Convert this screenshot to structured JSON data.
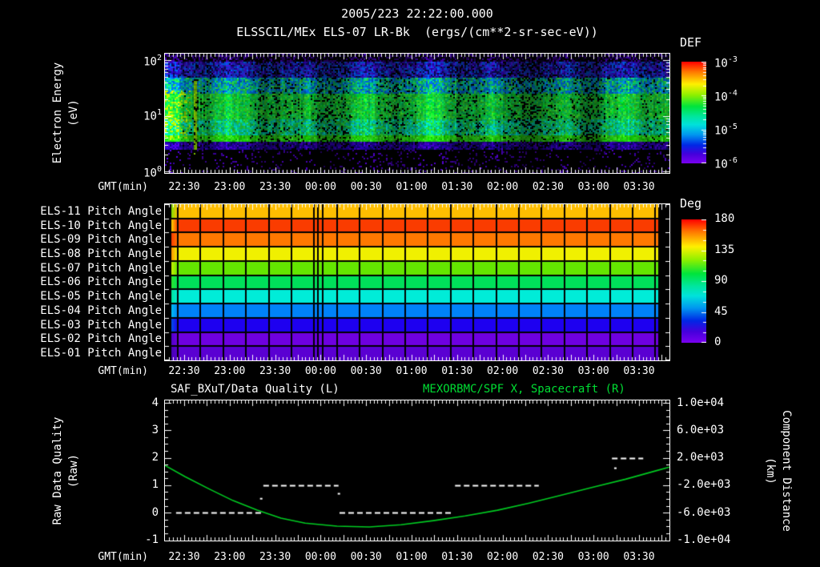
{
  "header": {
    "timestamp": "2005/223 22:22:00.000",
    "instrument_title": "ELSSCIL/MEx ELS-07 LR-Bk  (ergs/(cm**2-sr-sec-eV))"
  },
  "time_axis": {
    "label": "GMT(min)",
    "ticks": [
      "22:30",
      "23:00",
      "23:30",
      "00:00",
      "00:30",
      "01:00",
      "01:30",
      "02:00",
      "02:30",
      "03:00",
      "03:30"
    ]
  },
  "spectrogram_panel": {
    "ylabel_line1": "Electron Energy",
    "ylabel_line2": "(eV)",
    "ytick_exponents": [
      "2",
      "1",
      "0"
    ],
    "colorbar": {
      "title": "DEF",
      "tick_exponents": [
        "-3",
        "-4",
        "-5",
        "-6"
      ]
    }
  },
  "pitch_panel": {
    "colorbar": {
      "title": "Deg",
      "ticks": [
        "180",
        "135",
        "90",
        "45",
        "0"
      ]
    }
  },
  "quality_panel": {
    "title_left": "SAF_BXuT/Data Quality (L)",
    "title_right": "MEXORBMC/SPF X, Spacecraft (R)",
    "title_right_color": "#00DD33",
    "ylabel_left_line1": "Raw Data Quality",
    "ylabel_left_line2": "(Raw)",
    "ylabel_right_line1": "Component Distance",
    "ylabel_right_line2": "(km)",
    "yticks_left": [
      "4",
      "3",
      "2",
      "1",
      "0",
      "-1"
    ],
    "yticks_right": [
      "1.0e+04",
      "6.0e+03",
      "2.0e+03",
      "-2.0e+03",
      "-6.0e+03",
      "-1.0e+04"
    ]
  },
  "colors": {
    "background": "#000000",
    "frame": "#FFFFFF",
    "text": "#FFFFFF",
    "accent_green": "#00DD33",
    "rainbow": [
      [
        0,
        "#FF0000"
      ],
      [
        0.1,
        "#FF7800"
      ],
      [
        0.22,
        "#FFF000"
      ],
      [
        0.33,
        "#8CF000"
      ],
      [
        0.44,
        "#00E43C"
      ],
      [
        0.54,
        "#00E69E"
      ],
      [
        0.62,
        "#00E2DC"
      ],
      [
        0.72,
        "#0096F0"
      ],
      [
        0.82,
        "#0028E6"
      ],
      [
        0.91,
        "#4600DC"
      ],
      [
        1,
        "#7A00F0"
      ]
    ]
  },
  "chart_data": [
    {
      "type": "heatmap",
      "subtype": "energy-time electron spectrogram",
      "title": "ELSSCIL/MEx ELS-07 LR-Bk (ergs/(cm**2-sr-sec-eV))",
      "start_time": "2005/223 22:22:00.000",
      "xlabel": "GMT(min)",
      "x_ticks": [
        "22:30",
        "23:00",
        "23:30",
        "00:00",
        "00:30",
        "01:00",
        "01:30",
        "02:00",
        "02:30",
        "03:00",
        "03:30"
      ],
      "ylabel": "Electron Energy (eV)",
      "y_scale": "log",
      "y_ticks": [
        1,
        10,
        100
      ],
      "colorbar": {
        "title": "DEF",
        "units": "ergs/(cm**2-sr-sec-eV)",
        "scale": "log",
        "ticks": [
          0.001,
          0.0001,
          1e-05,
          1e-06
        ]
      },
      "description": "Broad green flux band (~1e-4) between roughly 4 and 50 eV across the whole interval; mottled dark blue/purple noise (~1e-6 to 1e-5) above ~60 eV; black with sparse purple speckles below ~3 eV; brighter yellow-green enhancement near 22:30 with a narrow bright vertical spike just after it.",
      "bands": [
        {
          "y": [
            0.0,
            0.055
          ],
          "mode": "noise",
          "colors": [
            "#0a0028",
            "#28006e",
            "#000000",
            "#3c00a0"
          ],
          "density": 0.8
        },
        {
          "y": [
            0.055,
            0.19
          ],
          "mode": "noise",
          "colors": [
            "#2800a0",
            "#1830cc",
            "#0054dc",
            "#3c14c8",
            "#0a0a50"
          ],
          "density": 1
        },
        {
          "y": [
            0.19,
            0.33
          ],
          "mode": "noise",
          "colors": [
            "#0082e6",
            "#00b4b4",
            "#00cc7a",
            "#28d246",
            "#0064dc"
          ],
          "density": 1
        },
        {
          "y": [
            0.33,
            0.55
          ],
          "mode": "noise",
          "colors": [
            "#28d232",
            "#00dc28",
            "#3ce028",
            "#00c864",
            "#14d24b"
          ],
          "density": 1
        },
        {
          "y": [
            0.55,
            0.685
          ],
          "mode": "noise",
          "colors": [
            "#00d278",
            "#00dcb4",
            "#28d232",
            "#00c8c8",
            "#14dc50"
          ],
          "density": 1
        },
        {
          "y": [
            0.685,
            0.735
          ],
          "mode": "noise",
          "colors": [
            "#28e114",
            "#3ce028",
            "#14d200"
          ],
          "density": 1
        },
        {
          "y": [
            0.735,
            0.8
          ],
          "mode": "noise",
          "colors": [
            "#2800b4",
            "#4600cc",
            "#1e0096",
            "#0a0a64"
          ],
          "density": 0.92
        },
        {
          "y": [
            0.8,
            1.01
          ],
          "mode": "sparse",
          "colors": [
            "#5000cc",
            "#3c00aa"
          ],
          "density": 0.1
        }
      ]
    },
    {
      "type": "heatmap",
      "subtype": "pitch angle panels (one row per anode)",
      "xlabel": "GMT(min)",
      "x_ticks": [
        "22:30",
        "23:00",
        "23:30",
        "00:00",
        "00:30",
        "01:00",
        "01:30",
        "02:00",
        "02:30",
        "03:00",
        "03:30"
      ],
      "colorbar": {
        "title": "Deg",
        "ticks": [
          180,
          135,
          90,
          45,
          0
        ]
      },
      "rows": [
        {
          "label": "ELS-11 Pitch Angle",
          "approx_value_deg": 150,
          "color": "#FFBE00",
          "lead_color": "#82E000"
        },
        {
          "label": "ELS-10 Pitch Angle",
          "approx_value_deg": 170,
          "color": "#FA3C00",
          "lead_color": "#FFD200"
        },
        {
          "label": "ELS-09 Pitch Angle",
          "approx_value_deg": 160,
          "color": "#FF7800",
          "lead_color": "#FA3C00"
        },
        {
          "label": "ELS-08 Pitch Angle",
          "approx_value_deg": 135,
          "color": "#F0F000",
          "lead_color": "#FF9600"
        },
        {
          "label": "ELS-07 Pitch Angle",
          "approx_value_deg": 117,
          "color": "#64E600",
          "lead_color": "#C8F000"
        },
        {
          "label": "ELS-06 Pitch Angle",
          "approx_value_deg": 96,
          "color": "#00E05A",
          "lead_color": "#2CE62C"
        },
        {
          "label": "ELS-05 Pitch Angle",
          "approx_value_deg": 75,
          "color": "#00ECD8",
          "lead_color": "#00E69B"
        },
        {
          "label": "ELS-04 Pitch Angle",
          "approx_value_deg": 55,
          "color": "#0082F8",
          "lead_color": "#00BEF0"
        },
        {
          "label": "ELS-03 Pitch Angle",
          "approx_value_deg": 33,
          "color": "#1E00F0",
          "lead_color": "#0050E6"
        },
        {
          "label": "ELS-02 Pitch Angle",
          "approx_value_deg": 15,
          "color": "#6E00E0",
          "lead_color": "#5000C8"
        },
        {
          "label": "ELS-01 Pitch Angle",
          "approx_value_deg": 12,
          "color": "#5A00D2",
          "lead_color": "#4600B4"
        }
      ],
      "grid": {
        "first_line_frac": 0.0254,
        "step_frac": 0.04508,
        "extra_line_fracs": [
          0.3032,
          0.3127
        ],
        "left_black_end_frac": 0.0127,
        "right_black_start_frac": 0.9778
      }
    },
    {
      "type": "line",
      "titles": [
        "SAF_BXuT/Data Quality (L)",
        "MEXORBMC/SPF X, Spacecraft (R)"
      ],
      "xlabel": "GMT(min)",
      "x_ticks": [
        "22:30",
        "23:00",
        "23:30",
        "00:00",
        "00:30",
        "01:00",
        "01:30",
        "02:00",
        "02:30",
        "03:00",
        "03:30"
      ],
      "axes": {
        "left": {
          "label": "Raw Data Quality (Raw)",
          "range": [
            -1,
            4
          ],
          "ticks": [
            4,
            3,
            2,
            1,
            0,
            -1
          ]
        },
        "right": {
          "label": "Component Distance (km)",
          "range": [
            -10000,
            10000
          ],
          "ticks": [
            10000,
            6000,
            2000,
            -2000,
            -6000,
            -10000
          ]
        }
      },
      "series": [
        {
          "name": "SAF_BXuT/Data Quality (L)",
          "axis": "left",
          "style": "white dashed horizontal step segments",
          "segments": [
            {
              "t_start": "22:24",
              "t_end": "23:21",
              "value": 0
            },
            {
              "t_start": "23:22",
              "t_end": "00:11",
              "value": 1
            },
            {
              "t_start": "00:12",
              "t_end": "01:26",
              "value": 0
            },
            {
              "t_start": "01:28",
              "t_end": "02:23",
              "value": 1
            },
            {
              "t_start": "03:12",
              "t_end": "03:32",
              "value": 2
            }
          ],
          "segment_fracs": [
            [
              0.022,
              0.194,
              0
            ],
            [
              0.195,
              0.344,
              1
            ],
            [
              0.346,
              0.568,
              0
            ],
            [
              0.575,
              0.741,
              1
            ],
            [
              0.886,
              0.948,
              2
            ]
          ],
          "stray_points_frac": [
            [
              0.19,
              0.51
            ],
            [
              0.344,
              0.69
            ],
            [
              0.892,
              1.62
            ]
          ]
        },
        {
          "name": "MEXORBMC/SPF X, Spacecraft (R)",
          "axis": "right",
          "style": "solid green curve",
          "color": "#00CC22",
          "x_frac": [
            0,
            0.04,
            0.087,
            0.135,
            0.183,
            0.23,
            0.278,
            0.341,
            0.405,
            0.468,
            0.532,
            0.595,
            0.659,
            0.722,
            0.786,
            0.849,
            0.913,
            0.976,
            1.0
          ],
          "values_left_axis": [
            1.72,
            1.31,
            0.87,
            0.44,
            0.09,
            -0.2,
            -0.38,
            -0.49,
            -0.52,
            -0.44,
            -0.29,
            -0.12,
            0.09,
            0.35,
            0.64,
            0.93,
            1.22,
            1.54,
            1.66
          ],
          "note": "km = 4000*value - 6000 on right axis; minimum ~ -8100 km near 00:25"
        }
      ]
    }
  ]
}
